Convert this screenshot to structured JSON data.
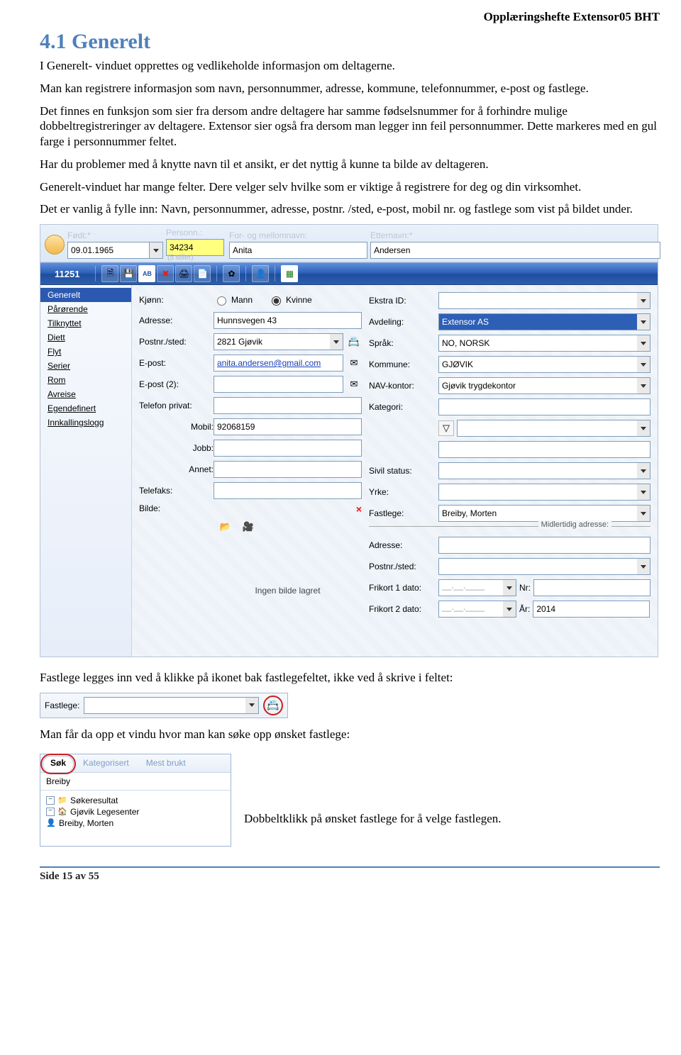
{
  "doc_header": "Opplæringshefte Extensor05 BHT",
  "section_title": "4.1 Generelt",
  "para1": "I Generelt- vinduet opprettes og vedlikeholde informasjon om deltagerne.",
  "para2": "Man kan registrere informasjon som navn, personnummer, adresse, kommune, telefonnummer, e-post og fastlege.",
  "para3": "Det finnes en funksjon som sier fra dersom andre deltagere har samme fødselsnummer for å forhindre mulige dobbeltregistreringer av deltagere. Extensor sier også fra dersom man legger inn feil personnummer. Dette markeres med en gul farge i personnummer feltet.",
  "para4": "Har du problemer med å knytte navn til et ansikt, er det nyttig å kunne ta bilde av deltageren.",
  "para5": "Generelt-vinduet har mange felter. Dere velger selv hvilke som er viktige å registrere for deg og din virksomhet.",
  "para6": "Det er vanlig å fylle inn: Navn, personnummer, adresse, postnr. /sted, e-post, mobil nr. og fastlege som vist på bildet under.",
  "titlebar": {
    "fodt_label": "Født:",
    "fodt_value": "09.01.1965",
    "pers_label": "Personn.:",
    "pers_value": "34234",
    "pers_hint": "(5 siffer)",
    "forn_label": "For- og mellomnavn:",
    "forn_value": "Anita",
    "ettern_label": "Etternavn:",
    "ettern_value": "Andersen"
  },
  "file_number": "11251",
  "sidebar": {
    "items": [
      "Generelt",
      "Pårørende",
      "Tilknyttet",
      "Diett",
      "Flyt",
      "Serier",
      "Rom",
      "Avreise",
      "Egendefinert",
      "Innkallingslogg"
    ]
  },
  "form": {
    "kjonn_label": "Kjønn:",
    "kjonn_opt1": "Mann",
    "kjonn_opt2": "Kvinne",
    "adresse_label": "Adresse:",
    "adresse_value": "Hunnsvegen 43",
    "post_label": "Postnr./sted:",
    "post_value": "2821 Gjøvik",
    "epost_label": "E-post:",
    "epost_value": "anita.andersen@gmail.com",
    "epost2_label": "E-post (2):",
    "tlfpriv_label": "Telefon privat:",
    "mobil_label": "Mobil:",
    "mobil_value": "92068159",
    "jobb_label": "Jobb:",
    "annet_label": "Annet:",
    "telefaks_label": "Telefaks:",
    "bilde_label": "Bilde:",
    "bilde_placeholder": "Ingen bilde lagret",
    "ekstraid_label": "Ekstra ID:",
    "avdeling_label": "Avdeling:",
    "avdeling_value": "Extensor AS",
    "sprak_label": "Språk:",
    "sprak_value": "NO, NORSK",
    "kommune_label": "Kommune:",
    "kommune_value": "GJØVIK",
    "nav_label": "NAV-kontor:",
    "nav_value": "Gjøvik trygdekontor",
    "kategori_label": "Kategori:",
    "sivil_label": "Sivil status:",
    "yrke_label": "Yrke:",
    "fastlege_label": "Fastlege:",
    "fastlege_value": "Breiby, Morten",
    "midl_label": "Midlertidig adresse:",
    "adresse2_label": "Adresse:",
    "post2_label": "Postnr./sted:",
    "frikort1_label": "Frikort 1 dato:",
    "frikort2_label": "Frikort 2 dato:",
    "nr_label": "Nr:",
    "aar_label": "År:",
    "aar_value": "2014"
  },
  "after_app_para": "Fastlege legges inn ved å klikke på ikonet bak fastlegefeltet, ikke ved å skrive i feltet:",
  "snip2_label": "Fastlege:",
  "after_snip2_para": "Man får da opp et vindu hvor man kan søke opp ønsket fastlege:",
  "search": {
    "tab1": "Søk",
    "tab2": "Kategorisert",
    "tab3": "Mest brukt",
    "query": "Breiby",
    "root": "Søkeresultat",
    "node1": "Gjøvik Legesenter",
    "node2": "Breiby, Morten"
  },
  "snip3_caption": "Dobbeltklikk på ønsket fastlege for å velge fastlegen.",
  "footer": "Side 15 av 55"
}
